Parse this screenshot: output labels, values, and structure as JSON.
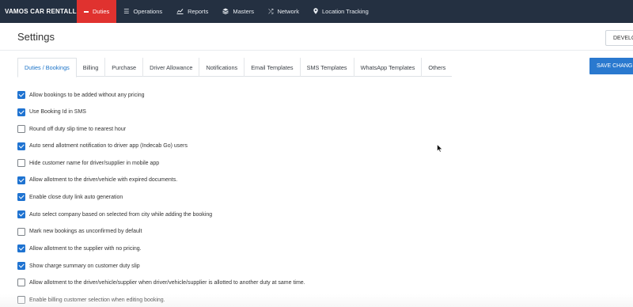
{
  "brand": "VAMOS CAR RENTALL",
  "nav": {
    "items": [
      {
        "label": "Duties",
        "icon": "dash-icon",
        "active": true
      },
      {
        "label": "Operations",
        "icon": "list-icon"
      },
      {
        "label": "Reports",
        "icon": "chart-icon"
      },
      {
        "label": "Masters",
        "icon": "stack-icon"
      },
      {
        "label": "Network",
        "icon": "shuffle-icon"
      },
      {
        "label": "Location Tracking",
        "icon": "map-pin-icon"
      }
    ]
  },
  "page": {
    "title": "Settings",
    "develop_label": "DEVELO",
    "save_label": "SAVE CHANG"
  },
  "tabs": [
    {
      "label": "Duties / Bookings",
      "active": true
    },
    {
      "label": "Billing"
    },
    {
      "label": "Purchase"
    },
    {
      "label": "Driver Allowance"
    },
    {
      "label": "Notifications"
    },
    {
      "label": "Email Templates"
    },
    {
      "label": "SMS Templates"
    },
    {
      "label": "WhatsApp Templates"
    },
    {
      "label": "Others"
    }
  ],
  "options": [
    {
      "label": "Allow bookings to be added without any pricing",
      "checked": true
    },
    {
      "label": "Use Booking Id in SMS",
      "checked": true
    },
    {
      "label": "Round off duty slip time to nearest hour",
      "checked": false
    },
    {
      "label": "Auto send allotment notification to driver app (Indecab Go) users",
      "checked": true
    },
    {
      "label": "Hide customer name for driver/supplier in mobile app",
      "checked": false
    },
    {
      "label": "Allow allotment to the driver/vehicle with expired documents.",
      "checked": true
    },
    {
      "label": "Enable close duty link auto generation",
      "checked": true
    },
    {
      "label": "Auto select company based on selected from city while adding the booking",
      "checked": true
    },
    {
      "label": "Mark new bookings as unconfirmed by default",
      "checked": false
    },
    {
      "label": "Allow allotment to the supplier with no pricing.",
      "checked": true
    },
    {
      "label": "Show charge summary on customer duty slip",
      "checked": true
    },
    {
      "label": "Allow allotment to the driver/vehicle/supplier when driver/vehicle/supplier is allotted to another duty at same time.",
      "checked": false
    },
    {
      "label": "Enable billing customer selection when editing booking.",
      "checked": false
    }
  ],
  "colors": {
    "navbar": "#243041",
    "active_nav": "#e0322f",
    "accent": "#2a79cf",
    "checkbox_checked": "#1f73d1"
  }
}
